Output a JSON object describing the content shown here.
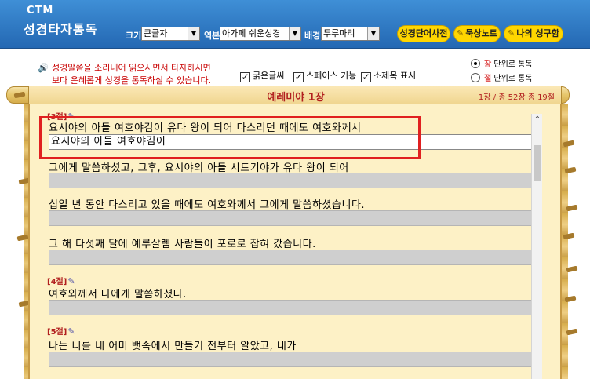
{
  "app": {
    "logo_top": "CTM",
    "logo_main": "성경타자통독"
  },
  "header": {
    "size_label": "크기",
    "size_value": "큰글자",
    "version_label": "역본",
    "version_value": "아가페 쉬운성경",
    "bg_label": "배경",
    "bg_value": "두루마리",
    "btn_dictionary": "성경단어사전",
    "btn_notes": "묵상노트",
    "btn_my_verse": "나의 성구함"
  },
  "info": {
    "notice_line1": "성경말씀을 소리내어 읽으시면서 타자하시면",
    "notice_line2": "보다 은혜롭게 성경을 통독하실 수 있습니다.",
    "check_bold": "굵은글씨",
    "check_space": "스페이스 기능",
    "check_subtitle": "소제목 표시",
    "radio_chapter_key": "장",
    "radio_chapter_rest": "단위로 통독",
    "radio_verse_key": "절",
    "radio_verse_rest": "단위로 통독"
  },
  "chapter": {
    "title": "예레미야 1장",
    "info": "1장 / 총 52장  총 19절"
  },
  "verses": [
    {
      "num": "[3절]",
      "line": "요시야의 아들 여호야김이 유다 왕이 되어 다스리던 때에도 여호와께서",
      "typed": "요시야의 아들 여호야김이"
    },
    {
      "num": "",
      "line": "그에게 말씀하셨고, 그후, 요시야의 아들 시드기야가 유다 왕이 되어",
      "typed": ""
    },
    {
      "num": "",
      "line": "십일 년 동안 다스리고 있을 때에도 여호와께서 그에게 말씀하셨습니다.",
      "typed": ""
    },
    {
      "num": "",
      "line": "그 해 다섯째 달에 예루살렘 사람들이 포로로 잡혀 갔습니다.",
      "typed": ""
    },
    {
      "num": "[4절]",
      "line": "여호와께서 나에게 말씀하셨다.",
      "typed": ""
    },
    {
      "num": "[5절]",
      "line": "나는 너를 네 어미 뱃속에서 만들기 전부터 알았고, 네가",
      "typed": ""
    }
  ],
  "colors": {
    "header_blue": "#2f7cc9",
    "accent_red": "#b11e1e",
    "highlight": "#e02020",
    "paper": "#fdf1c6"
  }
}
